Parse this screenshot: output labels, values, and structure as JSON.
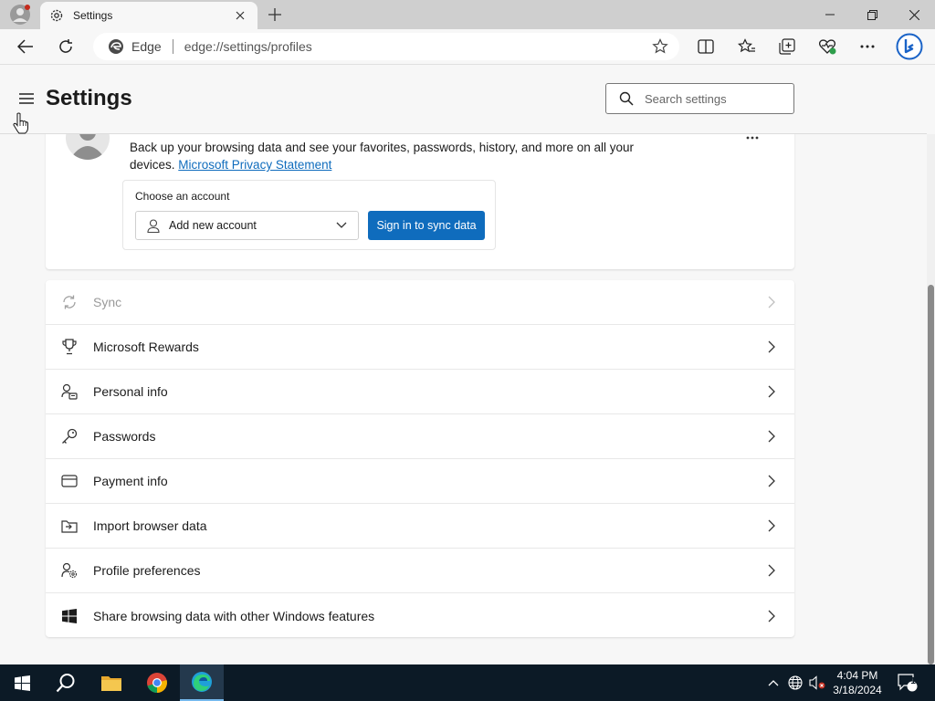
{
  "browser": {
    "tab_title": "Settings",
    "site_label": "Edge",
    "url": "edge://settings/profiles",
    "accent_color": "#0f6cbd"
  },
  "settings": {
    "title": "Settings",
    "search_placeholder": "Search settings"
  },
  "account_card": {
    "backup_text": "Back up your browsing data and see your favorites, passwords, history, and more on all your devices.",
    "privacy_link": "Microsoft Privacy Statement",
    "choose_label": "Choose an account",
    "select_value": "Add new account",
    "sync_button": "Sign in to sync data"
  },
  "profile_items": [
    {
      "label": "Sync",
      "icon": "sync-icon",
      "disabled": true
    },
    {
      "label": "Microsoft Rewards",
      "icon": "trophy-icon"
    },
    {
      "label": "Personal info",
      "icon": "person-card-icon"
    },
    {
      "label": "Passwords",
      "icon": "key-icon"
    },
    {
      "label": "Payment info",
      "icon": "credit-card-icon"
    },
    {
      "label": "Import browser data",
      "icon": "import-icon"
    },
    {
      "label": "Profile preferences",
      "icon": "person-gear-icon"
    },
    {
      "label": "Share browsing data with other Windows features",
      "icon": "windows-icon"
    }
  ],
  "taskbar": {
    "time": "4:04 PM",
    "date": "3/18/2024",
    "notification_count": "1"
  }
}
